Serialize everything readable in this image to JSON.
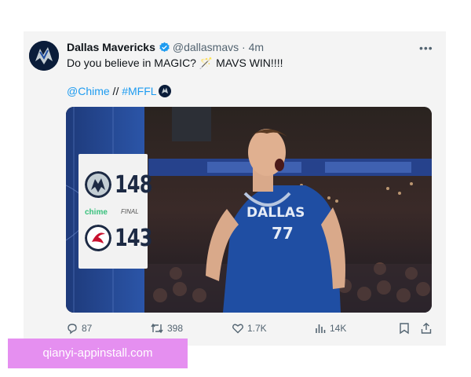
{
  "tweet": {
    "author_name": "Dallas Mavericks",
    "handle": "@dallasmavs",
    "separator": "·",
    "time": "4m",
    "more_label": "•••",
    "text_line1": "Do you believe in MAGIC? 🪄 MAVS WIN!!!!",
    "mention": "@Chime",
    "slashes": " // ",
    "hashtag": "#MFFL"
  },
  "scoreboard": {
    "home_score": "148",
    "away_score": "143",
    "sponsor": "chime",
    "status": "FINAL"
  },
  "actions": {
    "replies": "87",
    "reposts": "398",
    "likes": "1.7K",
    "views": "14K"
  },
  "watermark": "qianyi-appinstall.com",
  "colors": {
    "link": "#1d9bf0",
    "verified": "#1d9bf0",
    "jersey": "#1f4ea3",
    "banner": "#e58ff0"
  }
}
